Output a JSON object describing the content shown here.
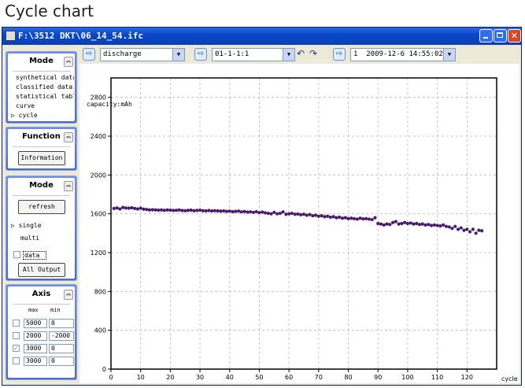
{
  "page": {
    "heading": "Cycle chart"
  },
  "window": {
    "title": "F:\\3512 DKT\\06_14_54.ifc"
  },
  "toolbar": {
    "mode_select": "discharge",
    "channel_select": "01-1-1:1",
    "record_select_index": "1",
    "record_select_date": "2009-12-6 14:55:02"
  },
  "sidebar": {
    "mode_panel": {
      "title": "Mode",
      "items": [
        "synthetical data",
        "classified data",
        "statistical table",
        "curve",
        "cycle"
      ],
      "selected_marker": "▷"
    },
    "function_panel": {
      "title": "Function",
      "button": "Information"
    },
    "mode2_panel": {
      "title": "Mode",
      "refresh": "refresh",
      "single": "single",
      "multi": "multi",
      "data_label": "data",
      "all_output": "All Output"
    },
    "axis_panel": {
      "title": "Axis",
      "col_max": "max",
      "col_min": "min",
      "rows": [
        {
          "max": "5000",
          "min": "0",
          "checked": false
        },
        {
          "max": "2000",
          "min": "-2000",
          "checked": false
        },
        {
          "max": "3000",
          "min": "0",
          "checked": true
        },
        {
          "max": "3000",
          "min": "0",
          "checked": false
        }
      ]
    }
  },
  "chart_data": {
    "type": "scatter",
    "ylabel": "capacity:mAh",
    "xlabel": "cycle",
    "xlim": [
      0,
      130
    ],
    "ylim": [
      0,
      3000
    ],
    "xticks": [
      0,
      10,
      20,
      30,
      40,
      50,
      60,
      70,
      80,
      90,
      100,
      110,
      120
    ],
    "yticks": [
      0,
      400,
      800,
      1200,
      1600,
      2000,
      2400,
      2800
    ],
    "grid": true,
    "marker_color": "#4b1a6e",
    "series": [
      {
        "x": [
          1,
          2,
          3,
          4,
          5,
          6,
          7,
          8,
          9,
          10,
          11,
          12,
          13,
          14,
          15,
          16,
          17,
          18,
          19,
          20,
          21,
          22,
          23,
          24,
          25,
          26,
          27,
          28,
          29,
          30,
          31,
          32,
          33,
          34,
          35,
          36,
          37,
          38,
          39,
          40,
          41,
          42,
          43,
          44,
          45,
          46,
          47,
          48,
          49,
          50,
          51,
          52,
          53,
          54,
          55,
          56,
          57,
          58,
          59,
          60,
          61,
          62,
          63,
          64,
          65,
          66,
          67,
          68,
          69,
          70,
          71,
          72,
          73,
          74,
          75,
          76,
          77,
          78,
          79,
          80,
          81,
          82,
          83,
          84,
          85,
          86,
          87,
          88,
          89,
          90,
          91,
          92,
          93,
          94,
          95,
          96,
          97,
          98,
          99,
          100,
          101,
          102,
          103,
          104,
          105,
          106,
          107,
          108,
          109,
          110,
          111,
          112,
          113,
          114,
          115,
          116,
          117,
          118,
          119,
          120,
          121,
          122,
          123,
          124,
          125
        ],
        "y": [
          1655,
          1660,
          1650,
          1665,
          1660,
          1658,
          1662,
          1655,
          1650,
          1658,
          1648,
          1645,
          1640,
          1642,
          1640,
          1638,
          1640,
          1636,
          1640,
          1638,
          1635,
          1636,
          1640,
          1634,
          1632,
          1636,
          1638,
          1632,
          1635,
          1638,
          1632,
          1630,
          1634,
          1630,
          1632,
          1630,
          1628,
          1630,
          1625,
          1628,
          1622,
          1625,
          1628,
          1620,
          1624,
          1618,
          1620,
          1615,
          1622,
          1612,
          1618,
          1610,
          1605,
          1600,
          1615,
          1600,
          1605,
          1620,
          1595,
          1600,
          1605,
          1595,
          1598,
          1590,
          1595,
          1585,
          1592,
          1580,
          1585,
          1575,
          1580,
          1570,
          1575,
          1565,
          1570,
          1560,
          1565,
          1555,
          1560,
          1550,
          1555,
          1550,
          1545,
          1555,
          1548,
          1550,
          1545,
          1540,
          1560,
          1500,
          1495,
          1485,
          1495,
          1490,
          1510,
          1520,
          1495,
          1500,
          1510,
          1500,
          1505,
          1495,
          1500,
          1490,
          1495,
          1485,
          1490,
          1480,
          1485,
          1480,
          1475,
          1485,
          1470,
          1465,
          1450,
          1470,
          1440,
          1455,
          1430,
          1440,
          1415,
          1440,
          1400,
          1430,
          1425
        ]
      }
    ]
  }
}
